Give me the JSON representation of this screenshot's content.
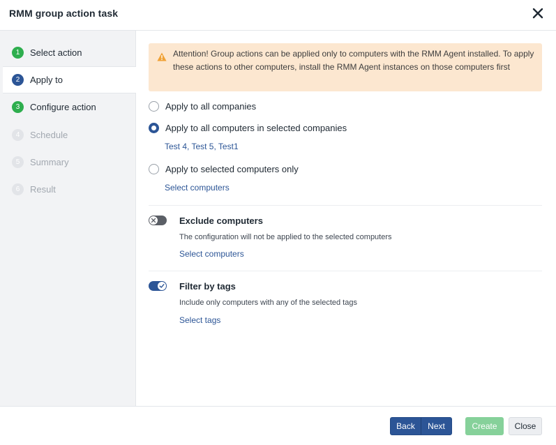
{
  "dialog": {
    "title": "RMM group action task"
  },
  "steps": [
    {
      "number": "1",
      "label": "Select action",
      "state": "done"
    },
    {
      "number": "2",
      "label": "Apply to",
      "state": "current"
    },
    {
      "number": "3",
      "label": "Configure action",
      "state": "done"
    },
    {
      "number": "4",
      "label": "Schedule",
      "state": "pending"
    },
    {
      "number": "5",
      "label": "Summary",
      "state": "pending"
    },
    {
      "number": "6",
      "label": "Result",
      "state": "pending"
    }
  ],
  "alert": {
    "icon": "warning-icon",
    "text": "Attention! Group actions can be applied only to computers with the RMM Agent installed. To apply these actions to other computers, install the RMM Agent instances on those computers first"
  },
  "apply_options": {
    "all_companies": "Apply to all companies",
    "selected_companies": "Apply to all computers in selected companies",
    "selected_companies_value": "Test 4, Test 5, Test1",
    "selected_computers": "Apply to selected computers only",
    "select_computers_link": "Select computers",
    "selected": "selected_companies"
  },
  "exclude": {
    "title": "Exclude computers",
    "description": "The configuration will not be applied to the selected computers",
    "link": "Select computers",
    "enabled": false
  },
  "filter_tags": {
    "title": "Filter by tags",
    "description": "Include only computers with any of the selected tags",
    "link": "Select tags",
    "enabled": true
  },
  "footer": {
    "back": "Back",
    "next": "Next",
    "create": "Create",
    "close": "Close"
  },
  "colors": {
    "primary": "#2c5596",
    "success": "#2eae4e",
    "alert_bg": "#fce7d0",
    "warning": "#f0a135"
  }
}
